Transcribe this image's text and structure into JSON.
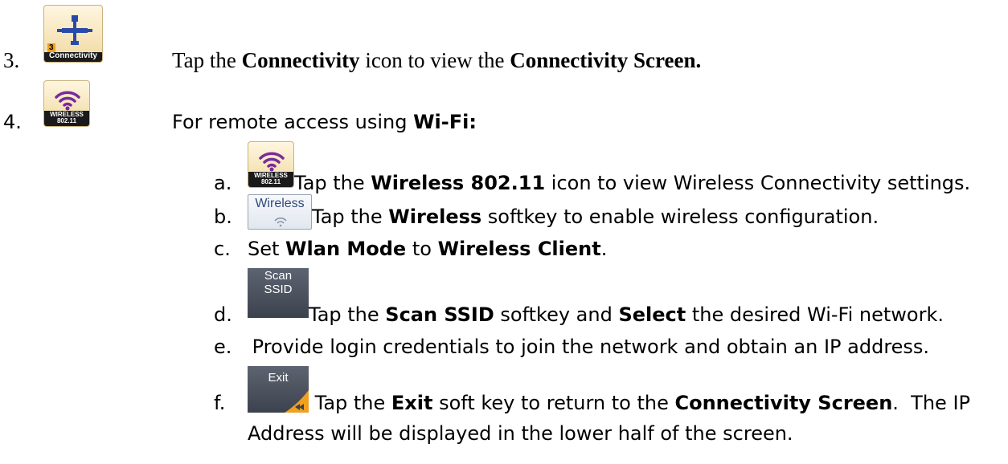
{
  "step3": {
    "number": "3.",
    "icon_label": "Connectivity",
    "icon_badge": "3",
    "text_pre": "Tap the ",
    "text_b1": "Connectivity",
    "text_mid": " icon to view the ",
    "text_b2": "Connectivity Screen."
  },
  "step4": {
    "number": "4.",
    "icon_label_line1": "WIRELESS",
    "icon_label_line2": "802.11",
    "text_pre": "For remote access using ",
    "text_b1": "Wi-Fi:"
  },
  "substeps": {
    "a": {
      "letter": "a.",
      "icon_label_line1": "WIRELESS",
      "icon_label_line2": "802.11",
      "text_pre": " Tap the ",
      "text_b1": "Wireless 802.11",
      "text_post": " icon to view Wireless Connectivity settings."
    },
    "b": {
      "letter": "b.",
      "button_label": "Wireless",
      "text_pre": " Tap the ",
      "text_b1": "Wireless",
      "text_post": " softkey to enable wireless configuration."
    },
    "c": {
      "letter": "c.",
      "text_pre": "Set ",
      "text_b1": "Wlan Mode",
      "text_mid": " to ",
      "text_b2": "Wireless Client",
      "text_post": "."
    },
    "d": {
      "letter": "d.",
      "button_label_line1": "Scan",
      "button_label_line2": "SSID",
      "text_pre": " Tap the ",
      "text_b1": "Scan SSID",
      "text_mid": " softkey and ",
      "text_b2": "Select",
      "text_post": " the desired Wi-Fi network."
    },
    "e": {
      "letter": "e.",
      "text": " Provide login credentials to join the network and obtain an IP address."
    },
    "f": {
      "letter": "f.",
      "button_label": "Exit",
      "text_pre": " Tap the ",
      "text_b1": "Exit",
      "text_mid": " soft key to return to the ",
      "text_b2": "Connectivity Screen",
      "text_post": ".  The IP",
      "text_line2": "Address will be displayed in the lower half of the screen."
    }
  },
  "colors": {
    "icon_bg": "#f0d9a0",
    "wifi_purple": "#7a2a9a",
    "connectivity_blue": "#2a4aa8",
    "connectivity_orange": "#f0a020"
  }
}
